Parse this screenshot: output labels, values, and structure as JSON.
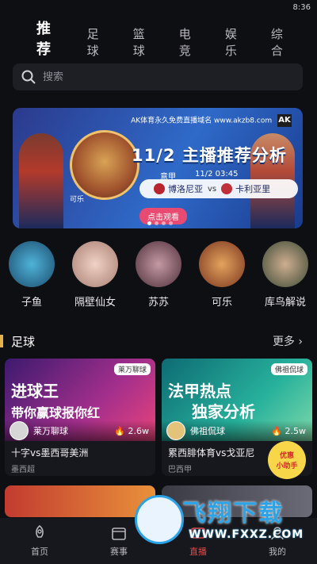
{
  "status": {
    "time": "8:36"
  },
  "tabs": [
    "推荐",
    "足球",
    "篮球",
    "电竞",
    "娱乐",
    "综合"
  ],
  "search": {
    "placeholder": "搜索"
  },
  "banner": {
    "brand": "AK体育永久免费直播域名 www.akzb8.com",
    "brand_mark": "AK",
    "headline": "11/2 主播推荐分析",
    "league": "意甲",
    "time": "11/2 03:45",
    "home": "博洛尼亚",
    "vs": "vs",
    "away": "卡利亚里",
    "cta": "点击观看",
    "tag": "可乐"
  },
  "anchors": [
    {
      "name": "子鱼",
      "color": "#2a6f9a"
    },
    {
      "name": "隔壁仙女",
      "color": "#d8b3a6"
    },
    {
      "name": "苏苏",
      "color": "#8a5a66"
    },
    {
      "name": "可乐",
      "color": "#c0683b"
    },
    {
      "name": "库鸟解说",
      "color": "#7c8a6a"
    }
  ],
  "section": {
    "title": "足球",
    "more": "更多"
  },
  "cards": [
    {
      "big1": "进球王",
      "big2": "带你赢球报你红",
      "badge": "莱万聊球",
      "user": "莱万聊球",
      "heat": "2.6w",
      "title": "十字vs墨西哥美洲",
      "league": "墨西超",
      "bg": "#7a2d8f"
    },
    {
      "big1": "法甲热点",
      "big2": "独家分析",
      "badge": "佛祖侃球",
      "user": "佛祖侃球",
      "heat": "2.5w",
      "title": "累西腓体育vs戈亚尼",
      "league": "巴西甲",
      "bg": "#1f9a8f"
    }
  ],
  "help_badge": {
    "line1": "优惠",
    "line2": "小助手"
  },
  "bottom_nav": [
    {
      "label": "首页",
      "active": false
    },
    {
      "label": "赛事",
      "active": false
    },
    {
      "label": "直播",
      "active": true
    },
    {
      "label": "我的",
      "active": false
    }
  ],
  "watermark": {
    "text": "飞翔下载",
    "url": "WWW.FXXZ.COM"
  }
}
